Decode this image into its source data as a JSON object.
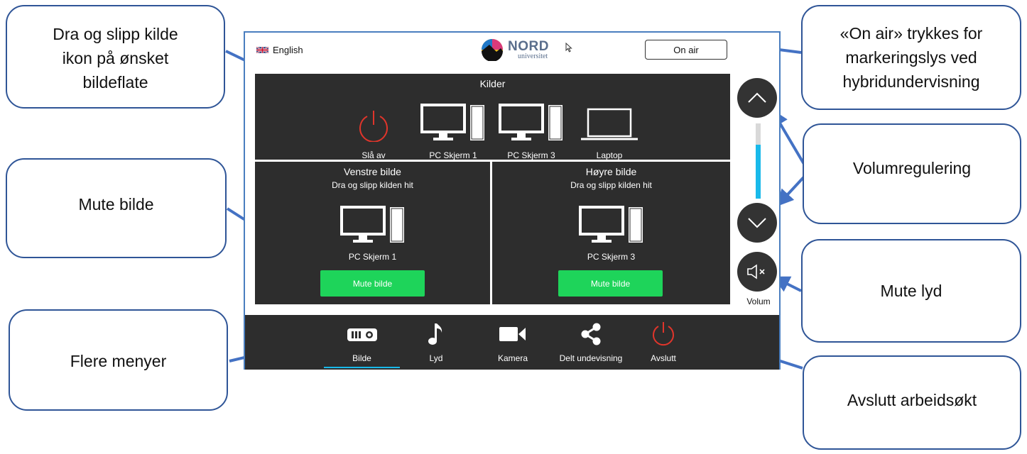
{
  "callouts": {
    "drag_drop": [
      "Dra og slipp kilde",
      "ikon på ønsket",
      "bildeflate"
    ],
    "on_air": [
      "«On air» trykkes for",
      "markeringslys ved",
      "hybridundervisning"
    ],
    "volume": "Volumregulering",
    "mute_picture": "Mute bilde",
    "mute_sound": "Mute lyd",
    "more_menus": "Flere menyer",
    "end_session": "Avslutt arbeidsøkt"
  },
  "panel": {
    "language": "English",
    "logo": {
      "main": "NORD",
      "sub": "universitet"
    },
    "on_air_label": "On air",
    "sources": {
      "title": "Kilder",
      "items": [
        {
          "label": "Slå av",
          "icon": "power-icon"
        },
        {
          "label": "PC Skjerm 1",
          "icon": "desktop-pc-icon"
        },
        {
          "label": "PC Skjerm 3",
          "icon": "desktop-pc-icon"
        },
        {
          "label": "Laptop",
          "icon": "laptop-icon"
        }
      ]
    },
    "left_display": {
      "title": "Venstre bilde",
      "hint": "Dra og slipp kilden hit",
      "source": "PC Skjerm 1",
      "mute_label": "Mute bilde"
    },
    "right_display": {
      "title": "Høyre bilde",
      "hint": "Dra og slipp kilden hit",
      "source": "PC Skjerm 3",
      "mute_label": "Mute bilde"
    },
    "volume": {
      "label": "Volum",
      "level": 0.72
    },
    "nav": [
      {
        "label": "Bilde",
        "icon": "projector-icon",
        "active": true
      },
      {
        "label": "Lyd",
        "icon": "music-note-icon"
      },
      {
        "label": "Kamera",
        "icon": "video-camera-icon"
      },
      {
        "label": "Delt undevisning",
        "icon": "share-icon"
      },
      {
        "label": "Avslutt",
        "icon": "power-icon"
      }
    ]
  },
  "colors": {
    "accent": "#19b9ea",
    "mute_green": "#1ed45a",
    "power_red": "#e0352b",
    "callout_border": "#2f5597",
    "arrow": "#4472c4",
    "dark_bg": "#2d2d2d"
  }
}
